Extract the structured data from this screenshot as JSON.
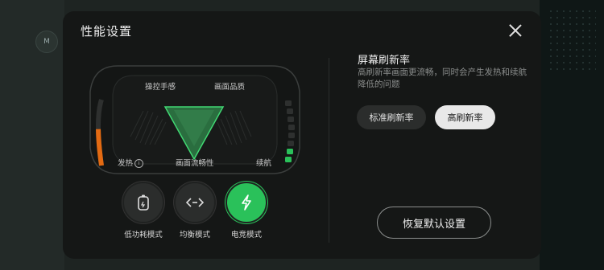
{
  "background": {
    "side_icon": "M"
  },
  "dialog": {
    "title": "性能设置",
    "close_icon": "close-icon"
  },
  "gauge": {
    "labels": {
      "control": "操控手感",
      "quality": "画面品质",
      "heat": "发热",
      "smoothness": "画面流畅性",
      "battery": "续航"
    },
    "info_icon": "i",
    "heat_level": 0.55,
    "battery_level": 0.25,
    "colors": {
      "heat": "#e36a12",
      "battery": "#2ac15a",
      "triangle": "#2e8a48"
    }
  },
  "modes": [
    {
      "label": "低功耗模式",
      "icon": "battery-icon",
      "active": false
    },
    {
      "label": "均衡模式",
      "icon": "balance-icon",
      "active": false
    },
    {
      "label": "电竞模式",
      "icon": "lightning-icon",
      "active": true
    }
  ],
  "refresh": {
    "title": "屏幕刷新率",
    "description": "高刷新率画面更流畅，同时会产生发热和续航降低的问题",
    "options": [
      {
        "label": "标准刷新率",
        "selected": false
      },
      {
        "label": "高刷新率",
        "selected": true
      }
    ]
  },
  "reset_label": "恢复默认设置",
  "accent_color": "#2ac15a"
}
